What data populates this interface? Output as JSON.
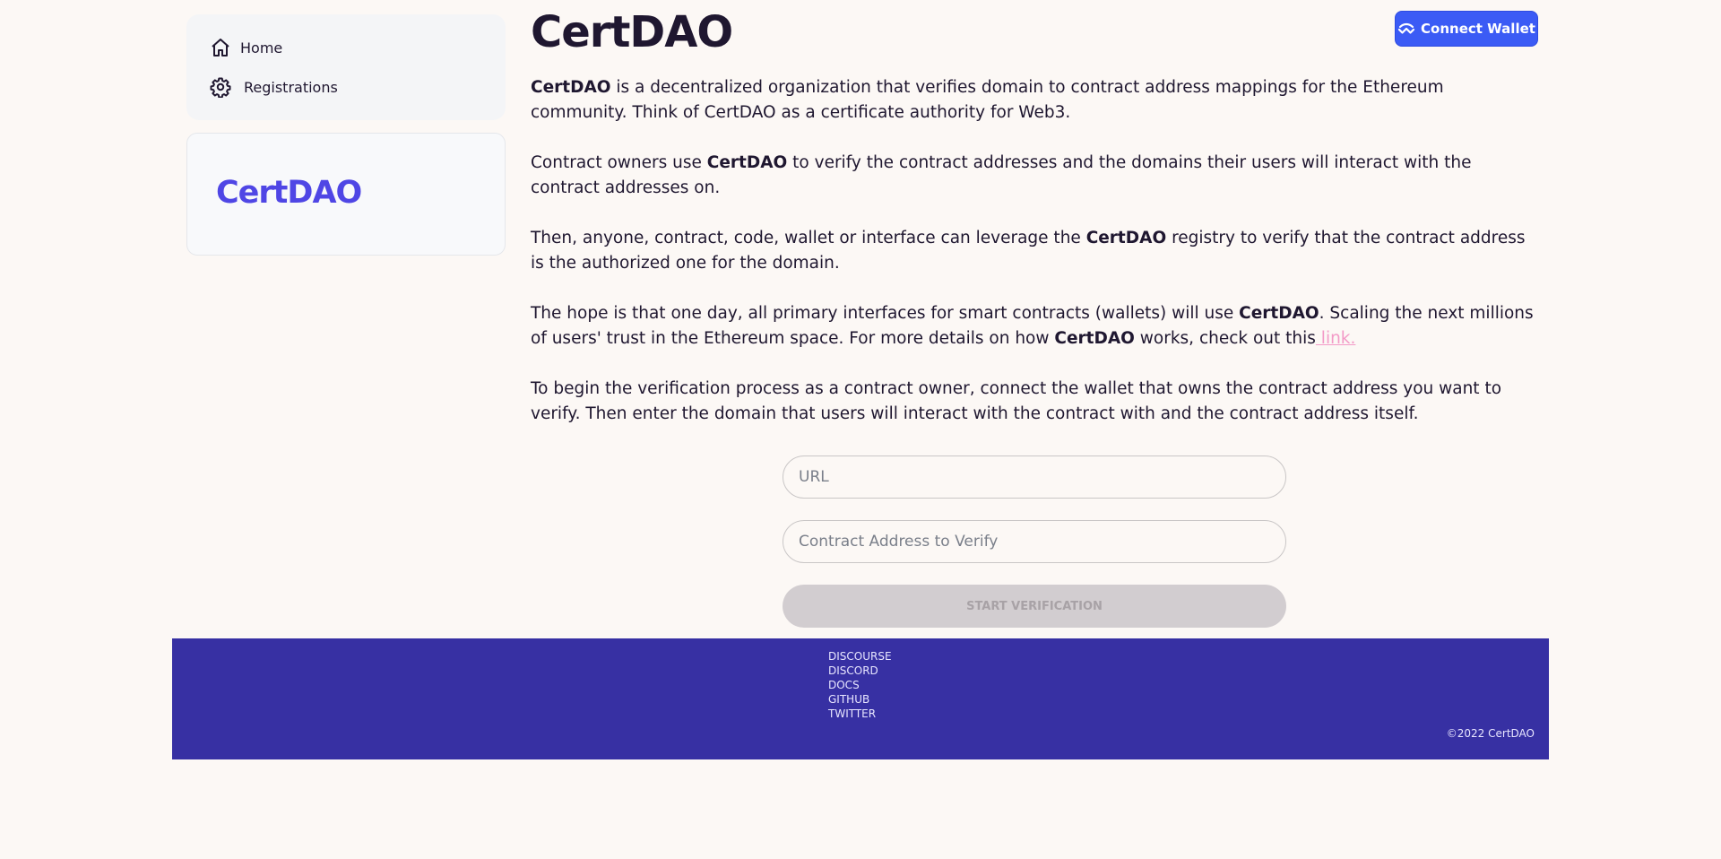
{
  "sidebar": {
    "items": [
      {
        "label": "Home",
        "icon": "home-icon"
      },
      {
        "label": "Registrations",
        "icon": "gear-icon"
      }
    ]
  },
  "logo_card": {
    "text": "CertDAO"
  },
  "header": {
    "title": "CertDAO",
    "connect_wallet_label": "Connect Wallet",
    "connect_wallet_icon": "walletconnect-icon"
  },
  "content": {
    "brand": "CertDAO",
    "p1_text": " is a decentralized organization that verifies domain to contract address mappings for the Ethereum community. Think of CertDAO as a certificate authority for Web3.",
    "p2_before": "Contract owners use ",
    "p2_after": " to verify the contract addresses and the domains their users will interact with the contract addresses on.",
    "p3_before": "Then, anyone, contract, code, wallet or interface can leverage the ",
    "p3_after": " registry to verify that the contract address is the authorized one for the domain.",
    "p4_before": "The hope is that one day, all primary interfaces for smart contracts (wallets) will use ",
    "p4_middle": ". Scaling the next millions of users' trust in the Ethereum space. For more details on how ",
    "p4_after": " works, check out this",
    "p4_link": " link.",
    "p5_text": "To begin the verification process as a contract owner, connect the wallet that owns the contract address you want to verify. Then enter the domain that users will interact with the contract with and the contract address itself."
  },
  "form": {
    "url_placeholder": "URL",
    "url_value": "",
    "address_placeholder": "Contract Address to Verify",
    "address_value": "",
    "start_label": "START VERIFICATION"
  },
  "footer": {
    "links": [
      "DISCOURSE",
      "DISCORD",
      "DOCS",
      "GITHUB",
      "TWITTER"
    ],
    "copyright": "©2022 CertDAO"
  },
  "colors": {
    "background": "#fcf8f5",
    "accent": "#4f46e5",
    "button": "#3b5bf5",
    "footer": "#3730a3",
    "link": "#f39ac7"
  }
}
